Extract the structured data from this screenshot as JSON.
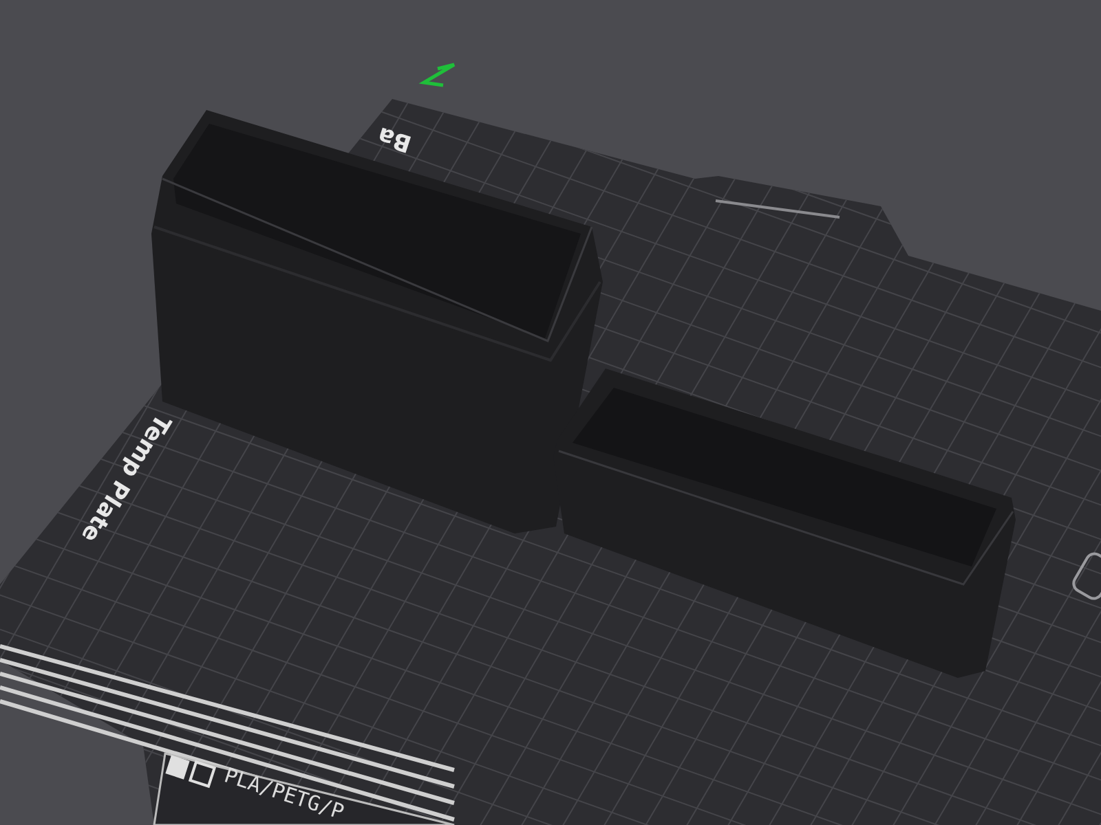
{
  "viewport": {
    "plate_texts": [
      {
        "text": "Ba"
      },
      {
        "text": "Temp Plate"
      }
    ],
    "plate_tab": {
      "text": "PLA/PETG/P"
    }
  }
}
